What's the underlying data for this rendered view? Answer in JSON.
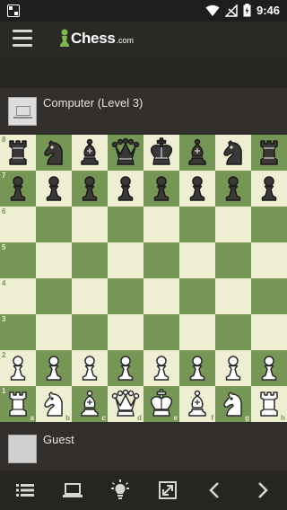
{
  "status_bar": {
    "time": "9:46"
  },
  "app": {
    "logo_text": "Chess",
    "logo_domain": ".com"
  },
  "players": {
    "opponent": {
      "name": "Computer (Level 3)"
    },
    "self": {
      "name": "Guest"
    }
  },
  "board": {
    "ranks_top_to_bottom": [
      "8",
      "7",
      "6",
      "5",
      "4",
      "3",
      "2",
      "1"
    ],
    "files": [
      "a",
      "b",
      "c",
      "d",
      "e",
      "f",
      "g",
      "h"
    ],
    "position": [
      [
        "bR",
        "bN",
        "bB",
        "bQ",
        "bK",
        "bB",
        "bN",
        "bR"
      ],
      [
        "bP",
        "bP",
        "bP",
        "bP",
        "bP",
        "bP",
        "bP",
        "bP"
      ],
      [
        "",
        "",
        "",
        "",
        "",
        "",
        "",
        ""
      ],
      [
        "",
        "",
        "",
        "",
        "",
        "",
        "",
        ""
      ],
      [
        "",
        "",
        "",
        "",
        "",
        "",
        "",
        ""
      ],
      [
        "",
        "",
        "",
        "",
        "",
        "",
        "",
        ""
      ],
      [
        "wP",
        "wP",
        "wP",
        "wP",
        "wP",
        "wP",
        "wP",
        "wP"
      ],
      [
        "wR",
        "wN",
        "wB",
        "wQ",
        "wK",
        "wB",
        "wN",
        "wR"
      ]
    ],
    "light_color": "#eeeed2",
    "dark_color": "#769656"
  },
  "toolbar": {
    "icons": [
      "list-icon",
      "computer-icon",
      "hint-bulb-icon",
      "flip-board-icon",
      "previous-move-icon",
      "next-move-icon"
    ]
  }
}
